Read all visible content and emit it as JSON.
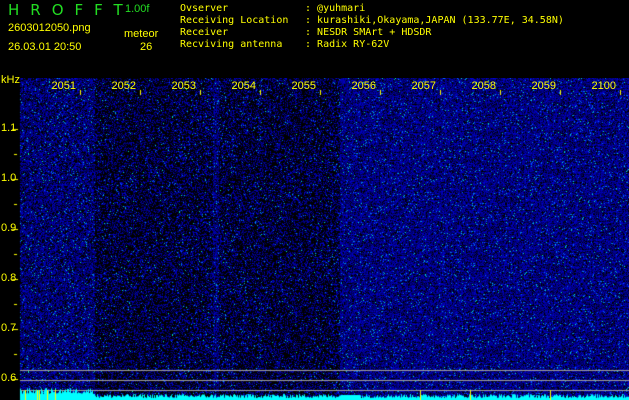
{
  "header": {
    "logo": "HROFFT",
    "version": "1.00f",
    "filename": "2603012050.png",
    "datetime": "26.03.01 20:50",
    "meteor_label": "meteor",
    "meteor_count": "26",
    "info": [
      {
        "label": "Ovserver",
        "value": "@yuhmari"
      },
      {
        "label": "Receiving Location",
        "value": "kurashiki,Okayama,JAPAN (133.77E, 34.58N)"
      },
      {
        "label": "Receiver",
        "value": "NESDR SMArt + HDSDR"
      },
      {
        "label": "Recviving antenna",
        "value": "Radix RY-62V"
      }
    ]
  },
  "axis": {
    "unit": "kHz",
    "time_labels": [
      "2051",
      "2052",
      "2053",
      "2054",
      "2055",
      "2056",
      "2057",
      "2058",
      "2059",
      "2100"
    ],
    "freq_labels": [
      "1.1",
      "1.0",
      "0.9",
      "0.8",
      "0.7",
      "0.6"
    ]
  },
  "colors": {
    "text": "#ffff00",
    "logo": "#22dd22",
    "histogram": "#00ffff"
  }
}
